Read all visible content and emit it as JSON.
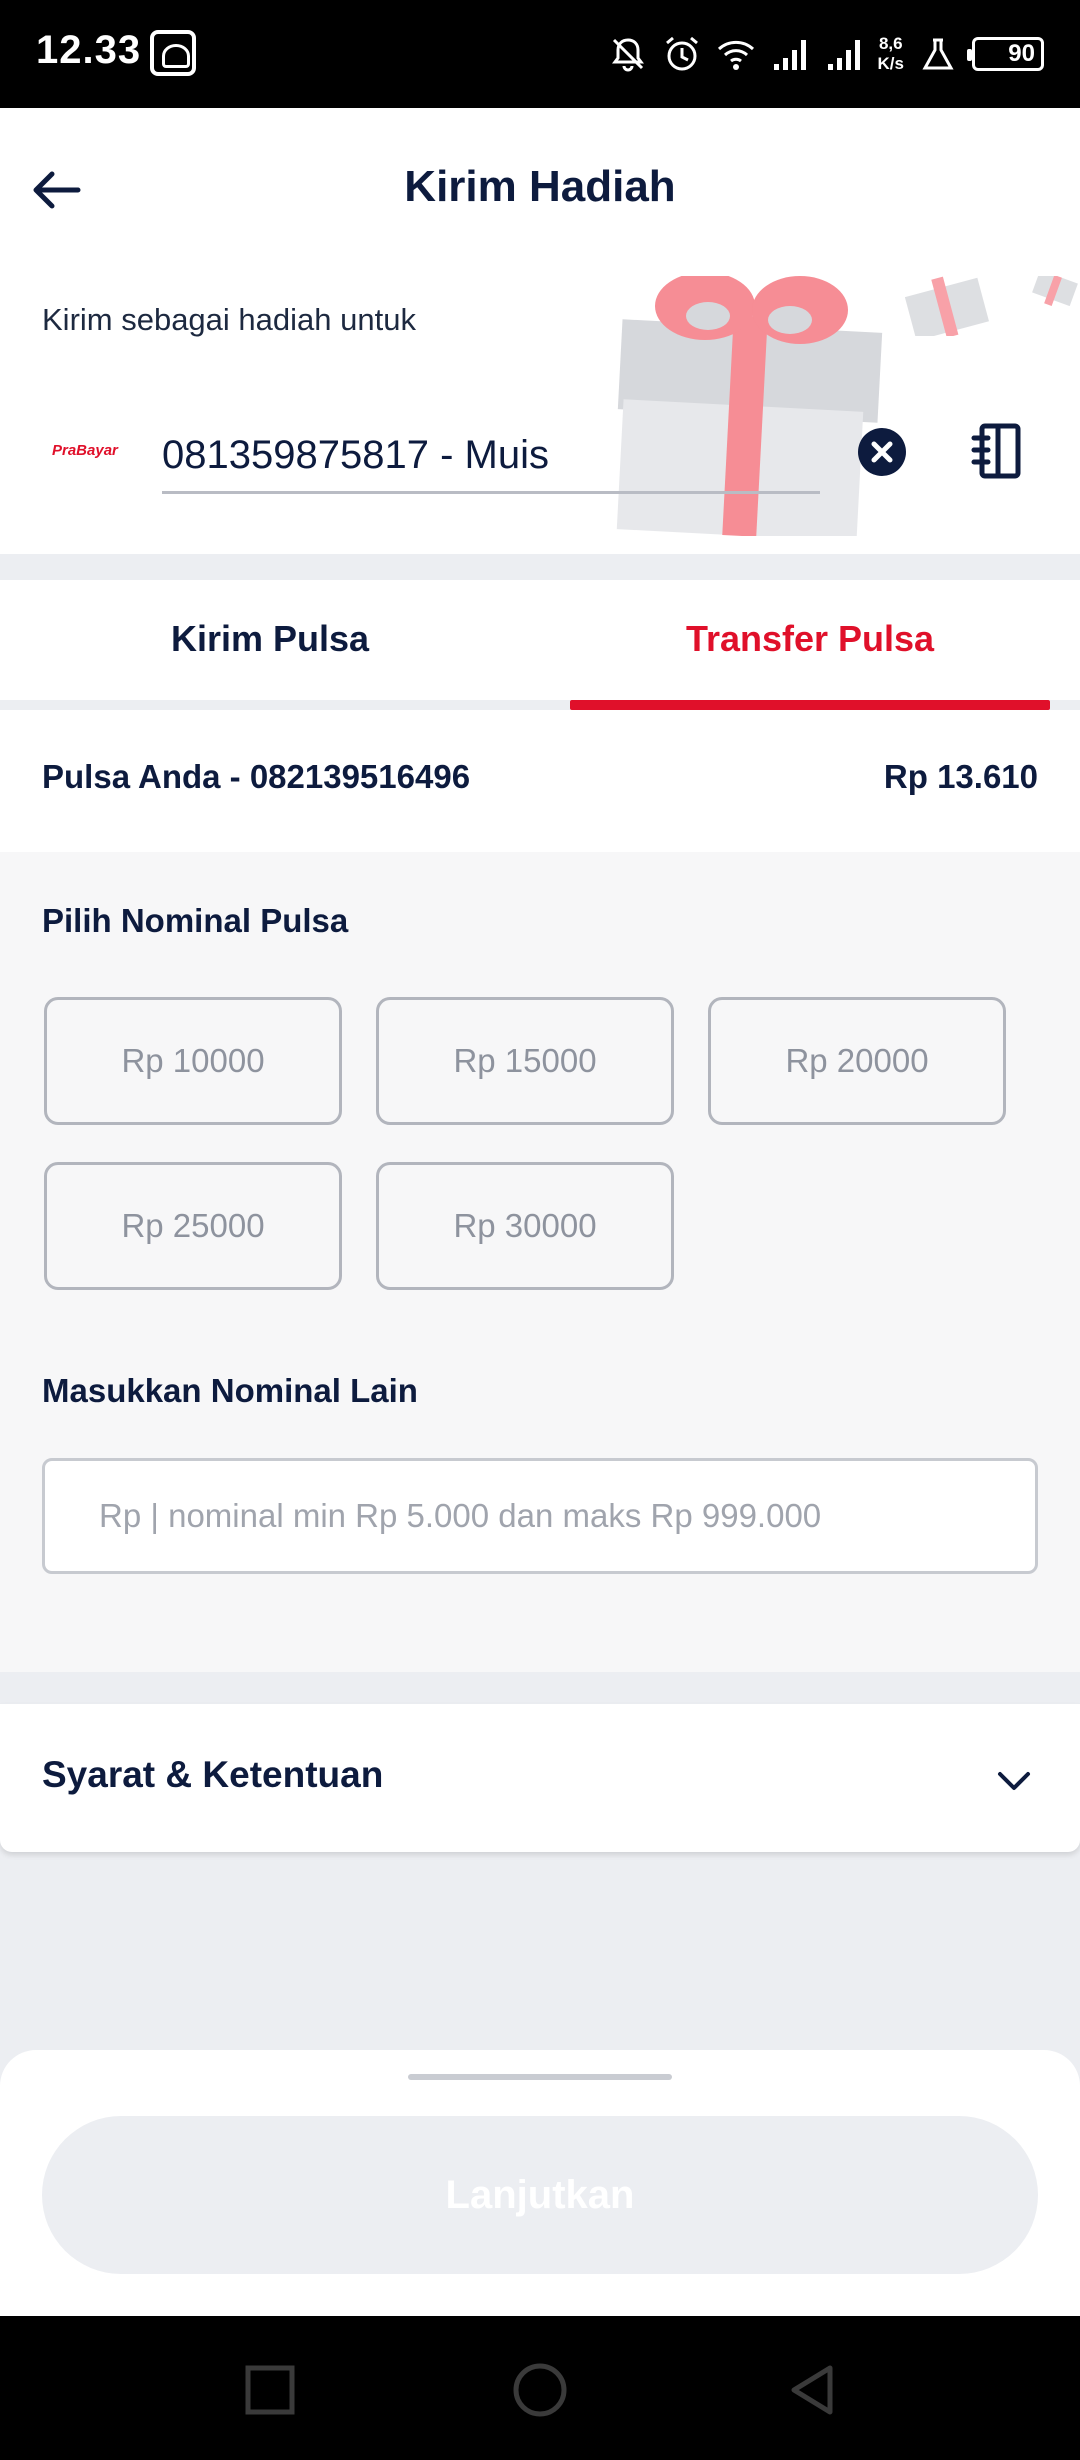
{
  "status_bar": {
    "time": "12.33",
    "net_speed_value": "8,6",
    "net_speed_unit": "K/s",
    "battery": "90",
    "icons": [
      "gallery-icon",
      "dnd-off-icon",
      "alarm-icon",
      "wifi-icon",
      "signal-icon",
      "signal-icon",
      "lab-icon"
    ]
  },
  "header": {
    "title": "Kirim Hadiah",
    "back_icon": "arrow-left-icon"
  },
  "recipient": {
    "label": "Kirim sebagai hadiah untuk",
    "operator_logo_text": "PraBayar",
    "phone_value": "081359875817 - Muis",
    "clear_icon": "close-circle-icon",
    "contacts_icon": "contact-book-icon",
    "decor_icon": "gift-icon"
  },
  "tabs": [
    {
      "label": "Kirim Pulsa",
      "active": false
    },
    {
      "label": "Transfer Pulsa",
      "active": true
    }
  ],
  "balance": {
    "label": "Pulsa Anda - 082139516496",
    "amount": "Rp 13.610"
  },
  "nominal": {
    "title": "Pilih Nominal Pulsa",
    "options": [
      "Rp 10000",
      "Rp 15000",
      "Rp 20000",
      "Rp 25000",
      "Rp 30000"
    ],
    "other_title": "Masukkan Nominal Lain",
    "other_placeholder": "Rp | nominal min Rp 5.000 dan maks Rp 999.000"
  },
  "terms": {
    "label": "Syarat & Ketentuan",
    "icon": "chevron-down-icon"
  },
  "bottom": {
    "cta_label": "Lanjutkan"
  },
  "colors": {
    "brand_red": "#e0102a",
    "navy": "#0d1b3e",
    "disabled_button": "#eceef2"
  }
}
